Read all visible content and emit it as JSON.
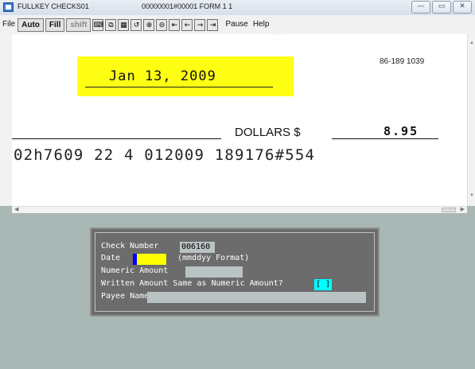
{
  "window": {
    "title": "FULLKEY CHECKS01",
    "subtitle": "00000001#00001 FORM  1  1",
    "controls": [
      "minimize",
      "maximize",
      "close"
    ]
  },
  "menu": {
    "file": "File",
    "pause": "Pause",
    "help": "Help"
  },
  "toolbar": {
    "auto": "Auto",
    "fill": "Fill",
    "shift": "shift",
    "icons": [
      "keyboard-icon",
      "window-icon",
      "grid-icon",
      "rotate-icon",
      "zoom-in-icon",
      "zoom-out-icon",
      "first-icon",
      "prev-icon",
      "next-icon",
      "last-icon"
    ]
  },
  "check": {
    "date": "Jan 13, 2009",
    "routing_fraction": "86-189 1039",
    "dollars_label": "DOLLARS $",
    "amount": "8.95",
    "micr_line": "02h7609 22 4 012009 189176#554"
  },
  "form": {
    "check_number_label": "Check Number",
    "check_number_value": "006160",
    "date_label": "Date",
    "date_hint": "(mmddyy Format)",
    "date_value": "",
    "numeric_amount_label": "Numeric Amount",
    "numeric_amount_value": "",
    "written_same_label": "Written Amount Same as Numeric Amount?",
    "written_same_value": "[ ]",
    "payee_label": "Payee Name",
    "payee_value": ""
  },
  "colors": {
    "highlight": "#ffff14",
    "background": "#a9b7b5",
    "panel": "#6c6c6c",
    "cursor": "#0000ff",
    "toggle": "#00ffff"
  }
}
